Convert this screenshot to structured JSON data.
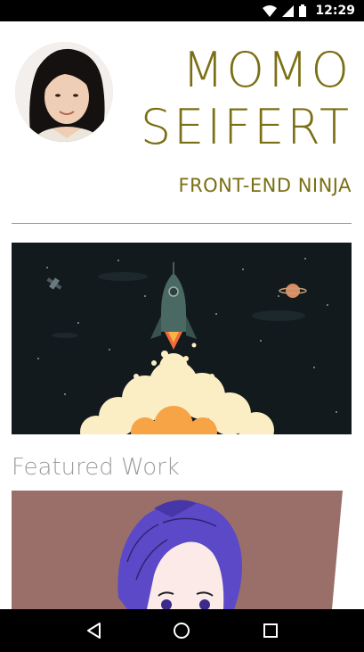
{
  "status_bar": {
    "time": "12:29"
  },
  "profile": {
    "first_name": "MOMO",
    "last_name": "SEIFERT",
    "job_title": "FRONT-END NINJA"
  },
  "sections": {
    "featured_title": "Featured Work"
  },
  "nav_bar": {
    "items": [
      "back",
      "home",
      "recents"
    ]
  },
  "colors": {
    "accent": "#7a6f14",
    "hero_bg": "#121a1d",
    "card_bg": "#9a6f6a",
    "section_title": "#9d9d9d"
  }
}
